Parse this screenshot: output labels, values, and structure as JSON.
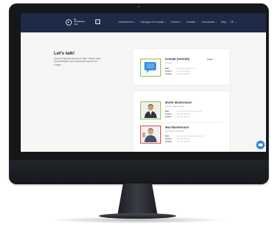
{
  "header": {
    "logo_text": "Dr. Commerce Ltd.",
    "nav": [
      "Unternehmen ⌄",
      "Lösungen & Produkte ⌄",
      "Karriere ⌄",
      "Kontakt ⌄",
      "Downloads ⌄",
      "Blog",
      "DE ⌄"
    ]
  },
  "intro": {
    "title": "Let's talk!",
    "text": "Unsere Experten sind per E-Mail, Telefon oder Chat verfügbar und beantworten gerne Ihre Fragen."
  },
  "contacts": [
    {
      "name": "Kontakt (Vertrieb)",
      "role": "Vertrieb",
      "tag": "Email",
      "fields": [
        [
          "Mail",
          "vertrieb@example.com"
        ],
        [
          "Telefon",
          "+49 000 000000"
        ],
        [
          "Telefax",
          "+49 000 000001"
        ]
      ]
    },
    {
      "name": "Martin Mustermann",
      "role": "Head of Sales Director",
      "tag": "",
      "fields": [
        [
          "Mail",
          "m.mustermann@example.com"
        ],
        [
          "Telefon",
          "+49 000 000002"
        ],
        [
          "Telefax",
          "+49 000 000003"
        ]
      ]
    },
    {
      "name": "Max Mustermann",
      "role": "Key Account Manager",
      "tag": "",
      "fields": [
        [
          "Mail",
          "max.mustermann@example.com"
        ],
        [
          "Telefon",
          "+49 000 000004"
        ],
        [
          "Telefax",
          "+49 000 000005"
        ]
      ]
    }
  ],
  "colors": {
    "header_bg": "#1f2a47",
    "accent_green": "#7fc441",
    "accent_red": "#d83a3a",
    "chat_blue": "#2e86d8"
  }
}
